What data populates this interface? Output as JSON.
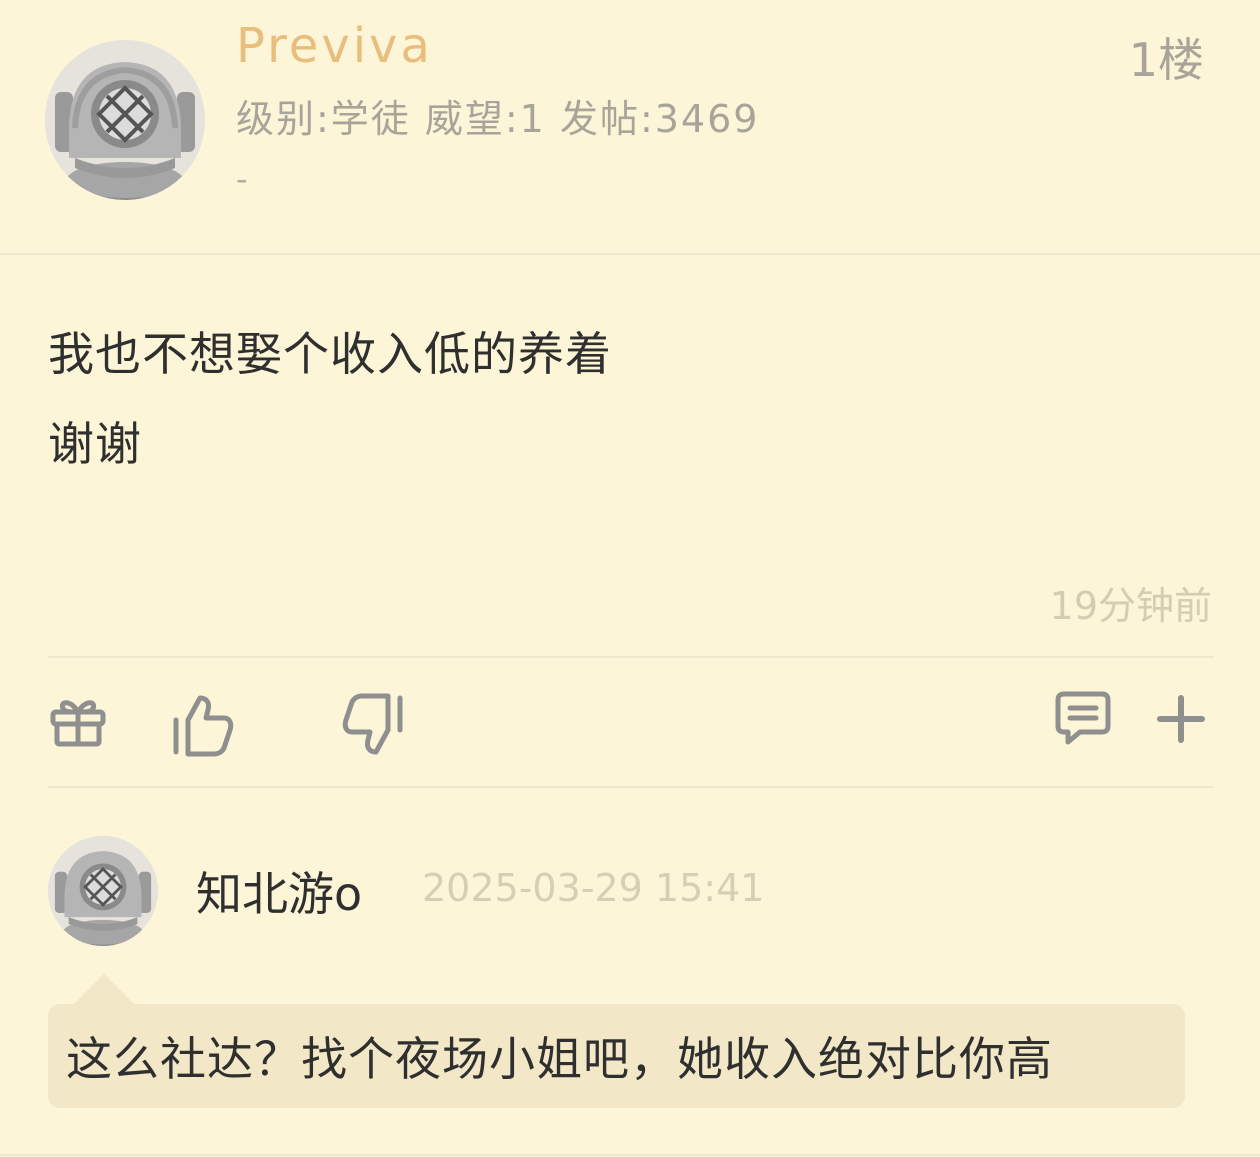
{
  "post": {
    "username": "Previva",
    "user_meta": "级别:学徒 威望:1 发帖:3469",
    "signature": "-",
    "floor": "1楼",
    "content_lines": [
      "我也不想娶个收入低的养着",
      "谢谢"
    ],
    "time_ago": "19分钟前"
  },
  "actions": {
    "icons": [
      "gift-icon",
      "thumbs-up-icon",
      "thumbs-down-icon",
      "comment-icon",
      "plus-icon"
    ]
  },
  "reply": {
    "username": "知北游o",
    "timestamp": "2025-03-29 15:41",
    "content": "这么社达？找个夜场小姐吧，她收入绝对比你高"
  },
  "colors": {
    "background": "#fdf5d7",
    "username": "#e9bd7b",
    "meta": "#a9a49a",
    "bubble": "#f2e7c6",
    "icon": "#8f8f8f"
  }
}
